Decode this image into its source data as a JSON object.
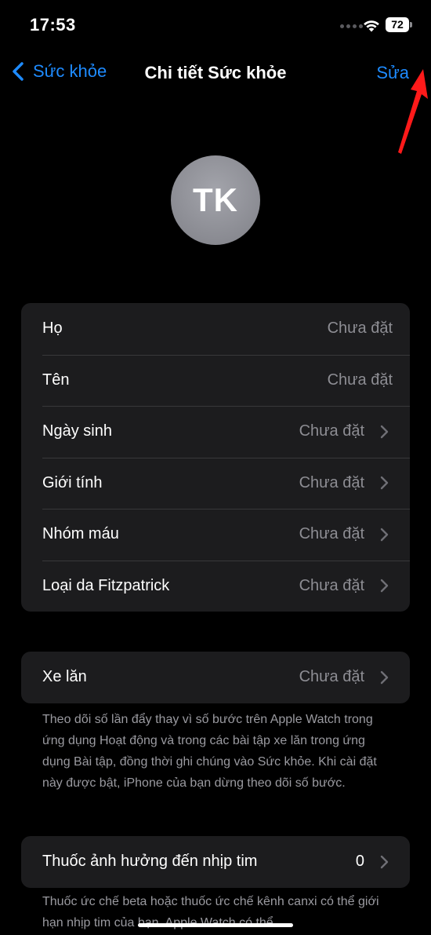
{
  "status_bar": {
    "time": "17:53",
    "battery": "72"
  },
  "nav": {
    "back_label": "Sức khỏe",
    "title": "Chi tiết Sức khỏe",
    "edit_label": "Sửa"
  },
  "profile": {
    "initials": "TK"
  },
  "personal_details": [
    {
      "label": "Họ",
      "value": "Chưa đặt"
    },
    {
      "label": "Tên",
      "value": "Chưa đặt"
    },
    {
      "label": "Ngày sinh",
      "value": "Chưa đặt"
    },
    {
      "label": "Giới tính",
      "value": "Chưa đặt"
    },
    {
      "label": "Nhóm máu",
      "value": "Chưa đặt"
    },
    {
      "label": "Loại da Fitzpatrick",
      "value": "Chưa đặt"
    }
  ],
  "wheelchair": {
    "label": "Xe lăn",
    "value": "Chưa đặt",
    "footnote": "Theo dõi số lần đẩy thay vì số bước trên Apple Watch trong ứng dụng Hoạt động và trong các bài tập xe lăn trong ứng dụng Bài tập, đồng thời ghi chúng vào Sức khỏe. Khi cài đặt này được bật, iPhone của bạn dừng theo dõi số bước."
  },
  "medications": {
    "label": "Thuốc ảnh hưởng đến nhịp tim",
    "value": "0",
    "footnote": "Thuốc ức chế beta hoặc thuốc ức chế kênh canxi có thể giới hạn nhịp tim của bạn. Apple Watch có thể"
  },
  "colors": {
    "accent": "#1e8bff",
    "annotation": "#ff1a1a"
  }
}
